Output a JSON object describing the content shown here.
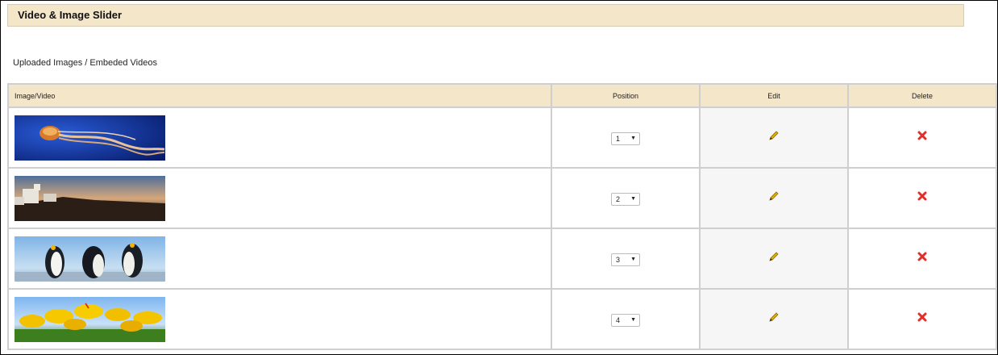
{
  "panel": {
    "title": "Video & Image Slider"
  },
  "section": {
    "subtitle": "Uploaded Images / Embeded Videos"
  },
  "table": {
    "headers": {
      "media": "Image/Video",
      "position": "Position",
      "edit": "Edit",
      "delete": "Delete"
    },
    "rows": [
      {
        "thumbnail_icon": "jellyfish-image",
        "position": "1"
      },
      {
        "thumbnail_icon": "coastal-lighthouse-image",
        "position": "2"
      },
      {
        "thumbnail_icon": "penguins-image",
        "position": "3"
      },
      {
        "thumbnail_icon": "yellow-tulips-image",
        "position": "4"
      }
    ]
  },
  "icons": {
    "edit": "pencil-icon",
    "delete": "red-x-icon",
    "dropdown": "chevron-down-icon"
  },
  "colors": {
    "header_bg": "#f4e6c9",
    "edit_bg": "#f6f6f6",
    "delete": "#e0302a",
    "pencil": "#e2b000"
  }
}
